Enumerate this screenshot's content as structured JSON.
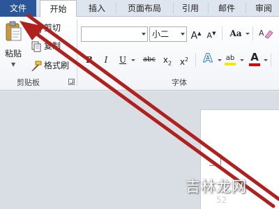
{
  "tabs": {
    "file": "文件",
    "home": "开始",
    "insert": "插入",
    "layout": "页面布局",
    "references": "引用",
    "mailings": "邮件",
    "review": "审阅"
  },
  "clipboard": {
    "paste": "粘贴",
    "cut": "剪切",
    "copy": "复制",
    "format_painter": "格式刷",
    "group_label": "剪贴板"
  },
  "font": {
    "font_name": "",
    "font_size": "小二",
    "grow_font": "A",
    "shrink_font": "A",
    "change_case": "Aa",
    "bold": "B",
    "italic": "I",
    "underline": "U",
    "strikethrough": "abc",
    "subscript": "x",
    "superscript": "x",
    "text_effects": "A",
    "highlight": "ab",
    "font_color": "A",
    "group_label": "字体"
  },
  "watermark": {
    "main": "吉林龙网",
    "sub": "52"
  },
  "colors": {
    "file_tab": "#2b579a",
    "arrow": "#b0201d",
    "highlight_yellow": "#ffe600",
    "font_color_red": "#e00000"
  }
}
